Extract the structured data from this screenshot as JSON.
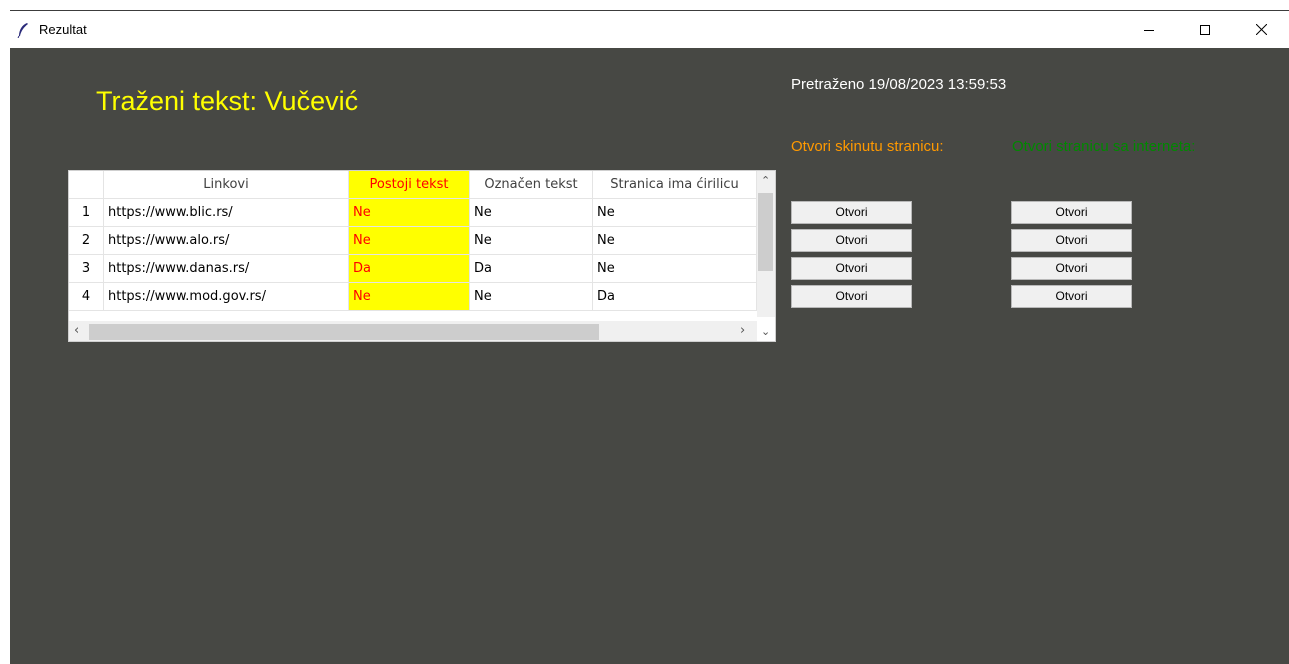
{
  "window": {
    "title": "Rezultat",
    "icons": {
      "app": "feather-icon",
      "minimize": "minimize-icon",
      "maximize": "maximize-icon",
      "close": "close-icon"
    }
  },
  "main": {
    "heading": "Traženi tekst: Vučević",
    "searched": "Pretraženo 19/08/2023 13:59:53",
    "open_downloaded_label": "Otvori skinutu stranicu:",
    "open_internet_label": "Otvori stranicu sa interneta:"
  },
  "table": {
    "columns": [
      "Linkovi",
      "Postoji tekst",
      "Označen tekst",
      "Stranica ima ćirilicu"
    ],
    "rows": [
      {
        "num": "1",
        "link": "https://www.blic.rs/",
        "exists": "Ne",
        "marked": "Ne",
        "cyrillic": "Ne"
      },
      {
        "num": "2",
        "link": "https://www.alo.rs/",
        "exists": "Ne",
        "marked": "Ne",
        "cyrillic": "Ne"
      },
      {
        "num": "3",
        "link": "https://www.danas.rs/",
        "exists": "Da",
        "marked": "Da",
        "cyrillic": "Ne"
      },
      {
        "num": "4",
        "link": "https://www.mod.gov.rs/",
        "exists": "Ne",
        "marked": "Ne",
        "cyrillic": "Da"
      }
    ]
  },
  "buttons": {
    "open_label": "Otvori"
  },
  "colors": {
    "background": "#474844",
    "heading": "#ffff00",
    "downloaded_label": "#ff9900",
    "internet_label": "#008800",
    "highlight_bg": "#ffff00",
    "highlight_text": "#ff0000"
  }
}
